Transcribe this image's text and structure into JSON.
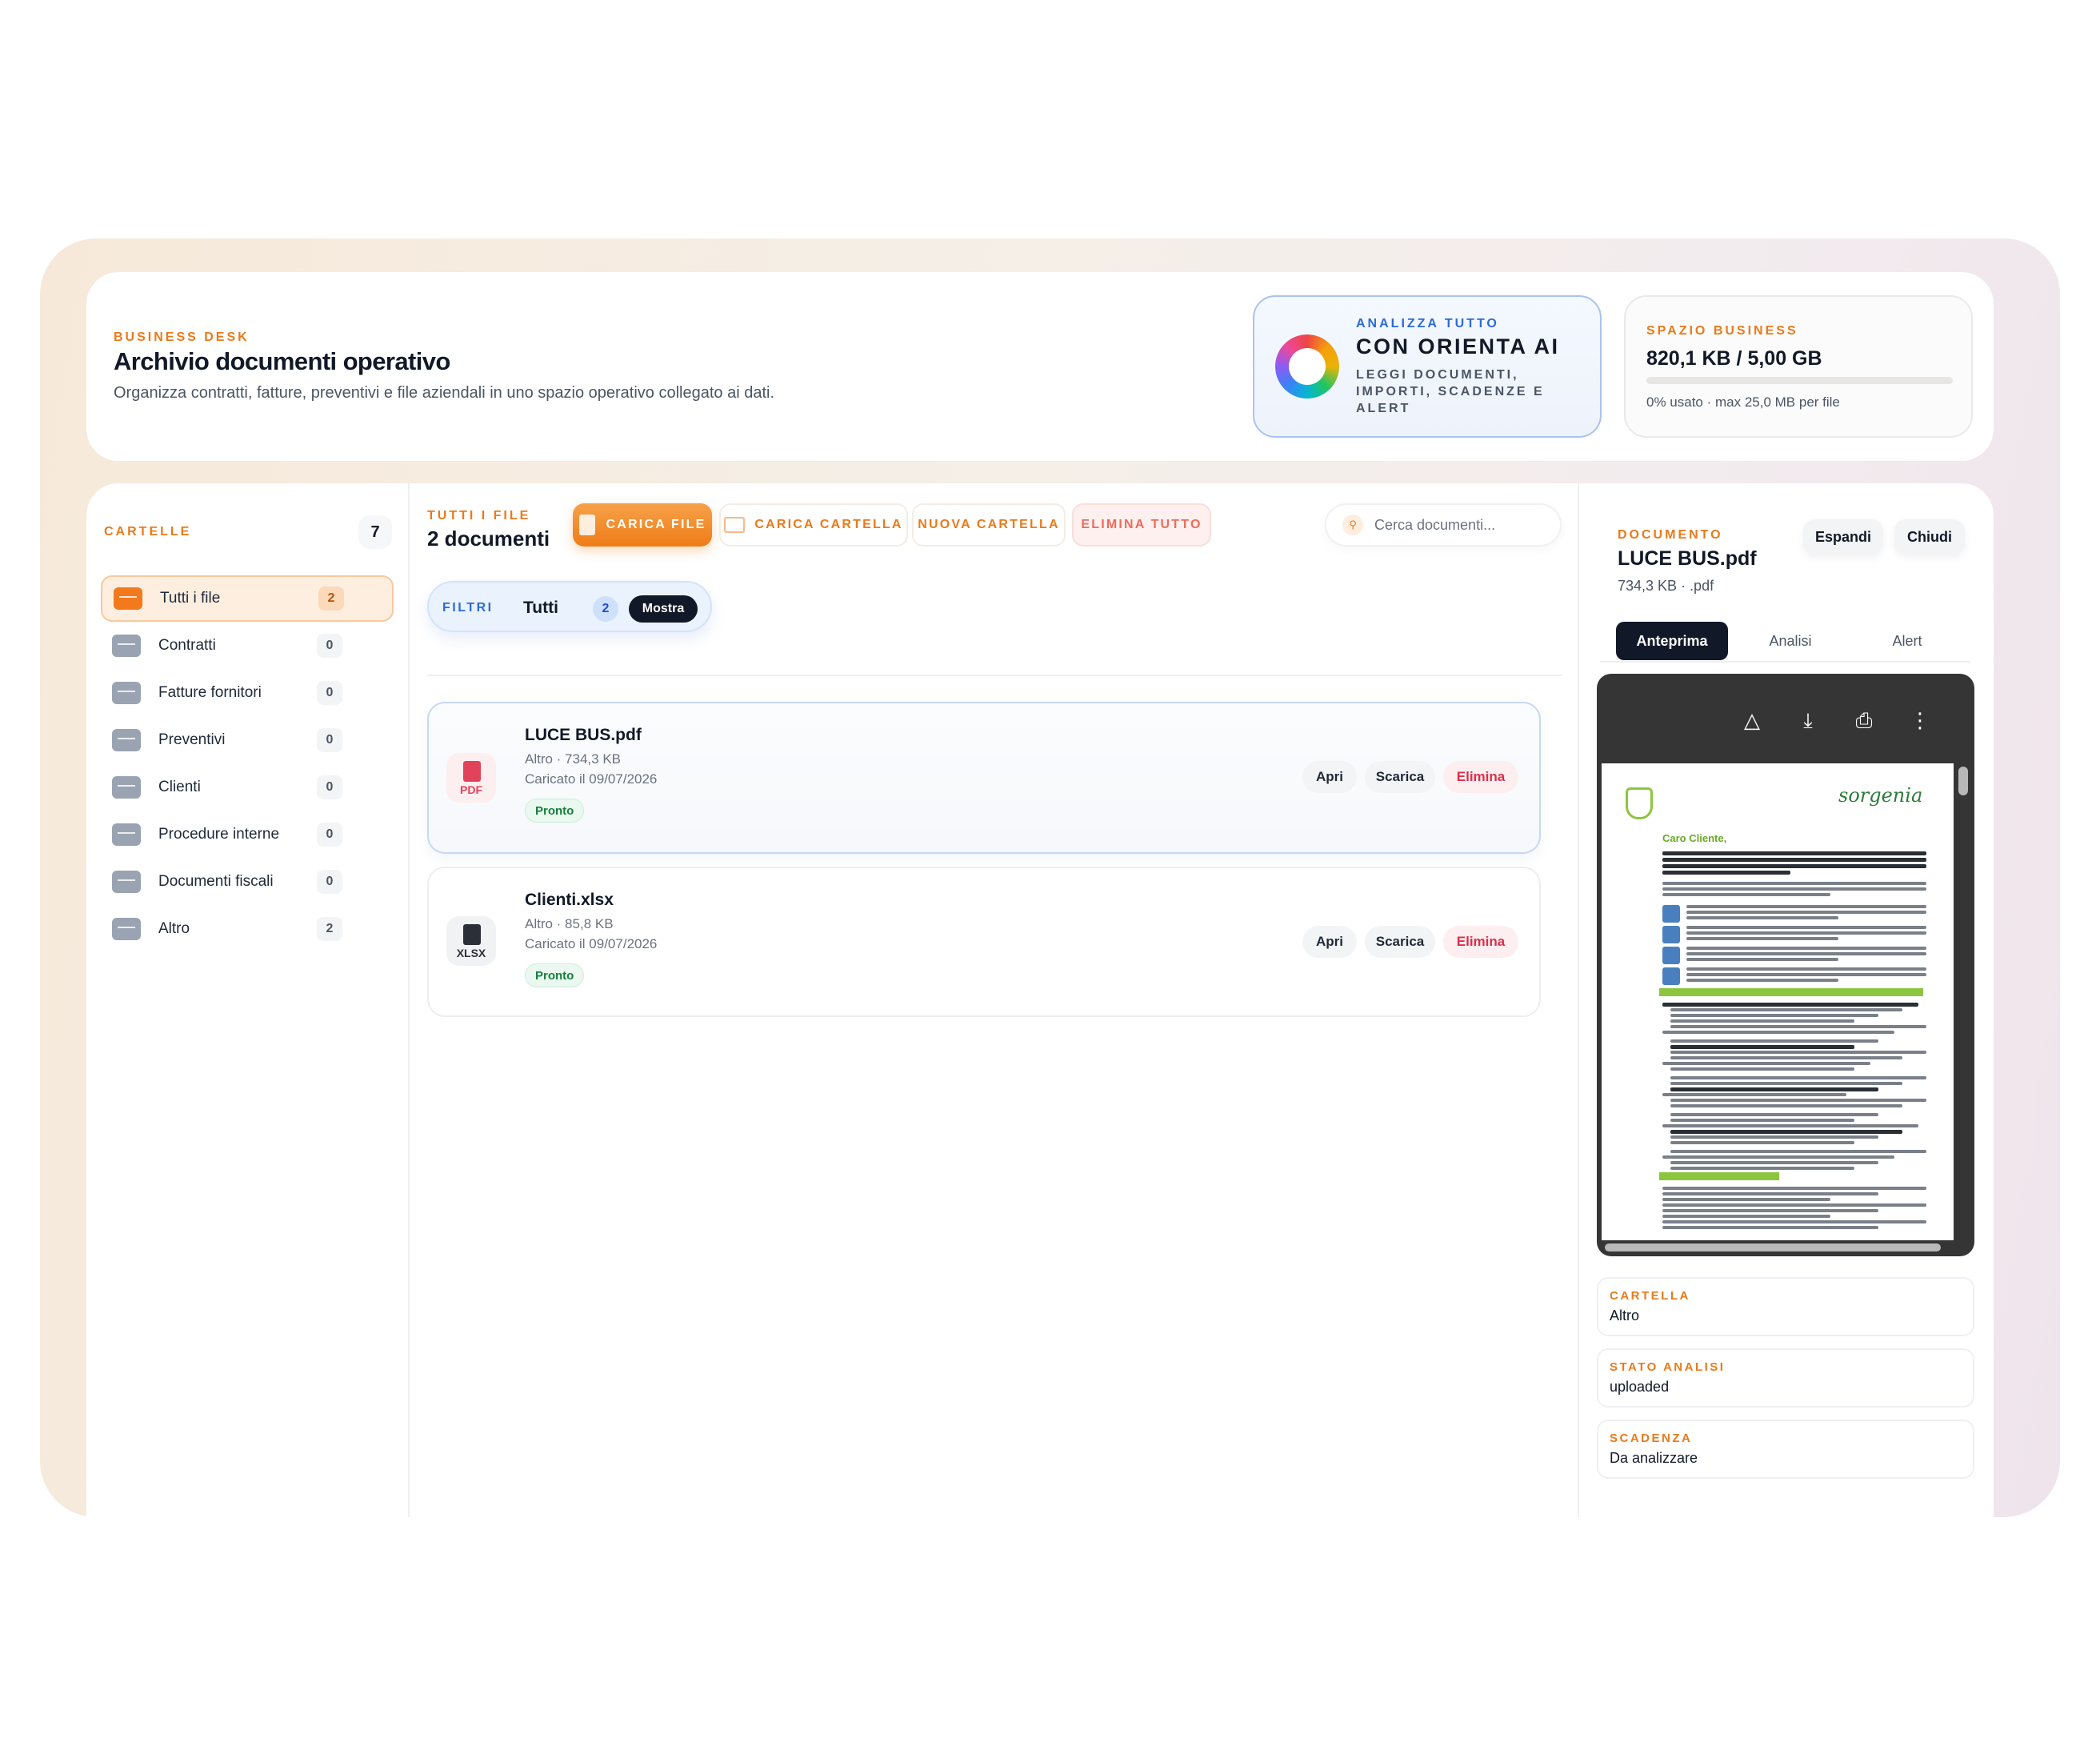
{
  "header": {
    "eyebrow": "BUSINESS DESK",
    "title": "Archivio documenti operativo",
    "subtitle": "Organizza contratti, fatture, preventivi e file aziendali in uno spazio operativo collegato ai dati."
  },
  "ai_card": {
    "eyebrow": "ANALIZZA TUTTO",
    "title": "CON ORIENTA AI",
    "subtitle": "LEGGI DOCUMENTI, IMPORTI, SCADENZE E ALERT"
  },
  "storage": {
    "eyebrow": "SPAZIO BUSINESS",
    "value": "820,1 KB / 5,00 GB",
    "note": "0% usato · max 25,0 MB per file",
    "used_fraction": 0.0002
  },
  "sidebar": {
    "title": "CARTELLE",
    "count": "7",
    "folders": [
      {
        "label": "Tutti i file",
        "count": "2",
        "active": true
      },
      {
        "label": "Contratti",
        "count": "0"
      },
      {
        "label": "Fatture fornitori",
        "count": "0"
      },
      {
        "label": "Preventivi",
        "count": "0"
      },
      {
        "label": "Clienti",
        "count": "0"
      },
      {
        "label": "Procedure interne",
        "count": "0"
      },
      {
        "label": "Documenti fiscali",
        "count": "0"
      },
      {
        "label": "Altro",
        "count": "2"
      }
    ]
  },
  "toolbar": {
    "eyebrow": "TUTTI I FILE",
    "title": "2 documenti",
    "upload_label": "CARICA FILE",
    "upload_folder_label": "CARICA CARTELLA",
    "new_folder_label": "NUOVA CARTELLA",
    "delete_all_label": "ELIMINA TUTTO",
    "search_placeholder": "Cerca documenti..."
  },
  "filters": {
    "label": "FILTRI",
    "value": "Tutti",
    "count": "2",
    "button": "Mostra"
  },
  "files": [
    {
      "ext": "PDF",
      "name": "LUCE BUS.pdf",
      "meta": "Altro · 734,3 KB",
      "uploaded": "Caricato il 09/07/2026",
      "status": "Pronto",
      "open": "Apri",
      "download": "Scarica",
      "delete": "Elimina"
    },
    {
      "ext": "XLSX",
      "name": "Clienti.xlsx",
      "meta": "Altro · 85,8 KB",
      "uploaded": "Caricato il 09/07/2026",
      "status": "Pronto",
      "open": "Apri",
      "download": "Scarica",
      "delete": "Elimina"
    }
  ],
  "detail": {
    "eyebrow": "DOCUMENTO",
    "title": "LUCE BUS.pdf",
    "meta": "734,3 KB · .pdf",
    "expand": "Espandi",
    "close": "Chiudi",
    "tabs": [
      "Anteprima",
      "Analisi",
      "Alert"
    ],
    "preview": {
      "logo": "sorgenia",
      "greeting": "Caro Cliente,"
    },
    "info": [
      {
        "key": "CARTELLA",
        "value": "Altro"
      },
      {
        "key": "STATO ANALISI",
        "value": "uploaded"
      },
      {
        "key": "SCADENZA",
        "value": "Da analizzare"
      }
    ]
  },
  "colors": {
    "accent": "#ea7a1a",
    "ai_blue": "#2b6bd8",
    "danger": "#dc2f4a",
    "success": "#15803d",
    "dark": "#111827"
  }
}
